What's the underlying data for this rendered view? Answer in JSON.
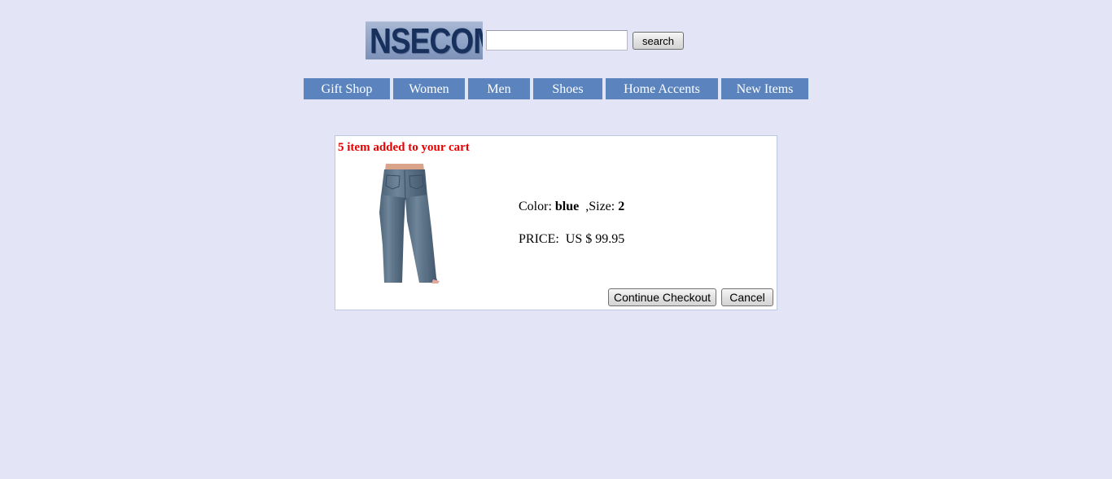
{
  "header": {
    "logo_text": "NSECOM",
    "search": {
      "value": "",
      "placeholder": "",
      "button_label": "search"
    }
  },
  "nav": {
    "items": [
      {
        "label": "Gift Shop"
      },
      {
        "label": "Women"
      },
      {
        "label": "Men"
      },
      {
        "label": "Shoes"
      },
      {
        "label": "Home Accents"
      },
      {
        "label": "New Items"
      }
    ]
  },
  "cart": {
    "message": "5 item added to your cart",
    "product": {
      "image": "jeans-image",
      "color_label": "Color: ",
      "color_value": "blue",
      "size_label": "  ,Size: ",
      "size_value": "2",
      "price_text": "PRICE:  US $ 99.95"
    },
    "continue_label": "Continue Checkout",
    "cancel_label": "Cancel"
  },
  "colors": {
    "page_background": "#e4e4f7",
    "nav_background": "#5b84be",
    "message_color": "#e60000"
  }
}
